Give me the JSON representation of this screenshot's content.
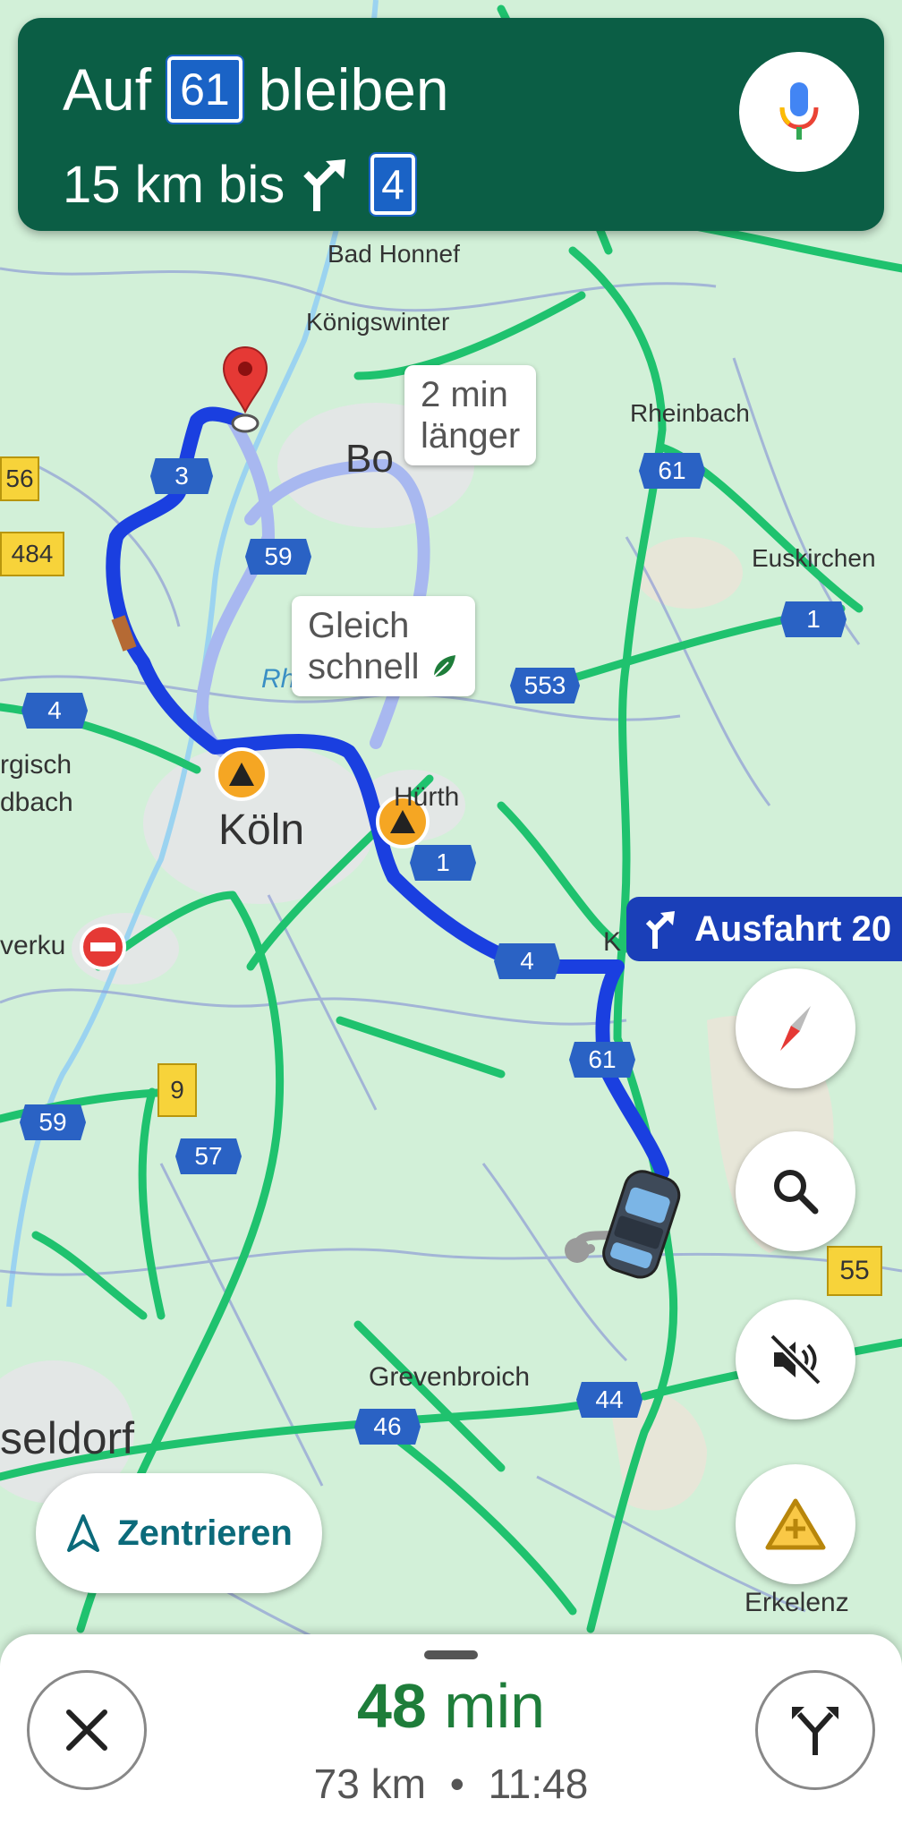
{
  "instruction": {
    "line1_prefix": "Auf",
    "road": "61",
    "line1_suffix": "bleiben",
    "distance": "15 km bis",
    "turn_icon": "turn-slight-right-icon",
    "next_road": "4"
  },
  "map": {
    "places": {
      "bad_honnef": "Bad Honnef",
      "koenigswinter": "Königswinter",
      "rheinbach": "Rheinbach",
      "bonn": "Bo",
      "euskirchen": "Euskirchen",
      "rhein": "Rh",
      "bergisch": "rgisch",
      "gladbach": "dbach",
      "koeln": "Köln",
      "huerth": "Hürth",
      "leverkusen": "verku",
      "kerpen": "K",
      "grevenbroich": "Grevenbroich",
      "duesseldorf": "seldorf",
      "erkelenz": "Erkelenz"
    },
    "shields_blue": {
      "a3": "3",
      "a59_top": "59",
      "a61_top": "61",
      "a1_right": "1",
      "a553": "553",
      "a4_left": "4",
      "a1_mid": "1",
      "a4_mid": "4",
      "a61_mid": "61",
      "a59_left": "59",
      "a57": "57",
      "a46": "46",
      "a44": "44"
    },
    "shields_yellow": {
      "b56": "56",
      "b484": "484",
      "b9": "9",
      "b55": "55"
    },
    "callouts": {
      "alt_longer_1": "2 min",
      "alt_longer_2": "länger",
      "alt_same_1": "Gleich",
      "alt_same_2": "schnell"
    },
    "exit_label": "Ausfahrt 20",
    "route_color": "#1a3fe0",
    "traffic_color": "#1fc26e"
  },
  "controls": {
    "recenter_label": "Zentrieren",
    "compass_icon": "compass-icon",
    "search_icon": "search-icon",
    "mute_icon": "volume-off-icon",
    "report_icon": "report-incident-icon"
  },
  "trip": {
    "duration_value": "48",
    "duration_unit": "min",
    "distance": "73 km",
    "separator": "•",
    "arrival": "11:48"
  }
}
